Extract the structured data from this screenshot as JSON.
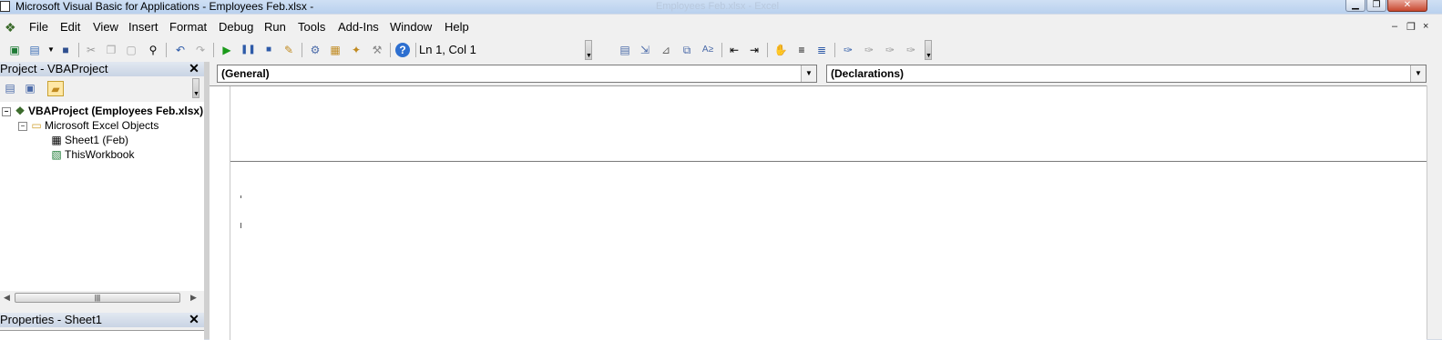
{
  "window": {
    "title": "Microsoft Visual Basic for Applications - Employees Feb.xlsx -",
    "ghost_title": "Employees Feb.xlsx - Excel",
    "buttons": {
      "minimize": "▁",
      "restore": "❐",
      "close": "✕"
    }
  },
  "menubar": {
    "items": [
      "File",
      "Edit",
      "View",
      "Insert",
      "Format",
      "Debug",
      "Run",
      "Tools",
      "Add-Ins",
      "Window",
      "Help"
    ],
    "mdi": {
      "minimize": "–",
      "restore": "❐",
      "close": "×"
    }
  },
  "toolbar": {
    "position": "Ln 1, Col 1",
    "icons": [
      "excel-icon",
      "insert-userform-icon",
      "save-icon",
      "cut-icon",
      "copy-icon",
      "paste-icon",
      "find-icon",
      "undo-icon",
      "redo-icon",
      "run-icon",
      "break-icon",
      "reset-icon",
      "design-mode-icon",
      "project-explorer-icon",
      "properties-icon",
      "object-browser-icon",
      "toolbox-icon",
      "help-icon",
      "list-properties-icon",
      "list-constants-icon",
      "quick-info-icon",
      "parameter-info-icon",
      "complete-word-icon",
      "indent-icon",
      "outdent-icon",
      "toggle-breakpoint-icon",
      "comment-block-icon",
      "uncomment-block-icon",
      "toggle-bookmark-icon",
      "next-bookmark-icon",
      "previous-bookmark-icon",
      "clear-bookmarks-icon"
    ]
  },
  "project_panel": {
    "title": "Project - VBAProject",
    "tree": [
      {
        "label": "VBAProject (Employees Feb.xlsx)",
        "level": 0,
        "icon": "vba-project-icon",
        "expanded": true
      },
      {
        "label": "Microsoft Excel Objects",
        "level": 1,
        "icon": "folder-icon",
        "expanded": true
      },
      {
        "label": "Sheet1 (Feb)",
        "level": 2,
        "icon": "worksheet-icon"
      },
      {
        "label": "ThisWorkbook",
        "level": 2,
        "icon": "workbook-icon"
      }
    ]
  },
  "properties_panel": {
    "title": "Properties - Sheet1"
  },
  "code_window": {
    "object_combo": "(General)",
    "procedure_combo": "(Declarations)"
  }
}
